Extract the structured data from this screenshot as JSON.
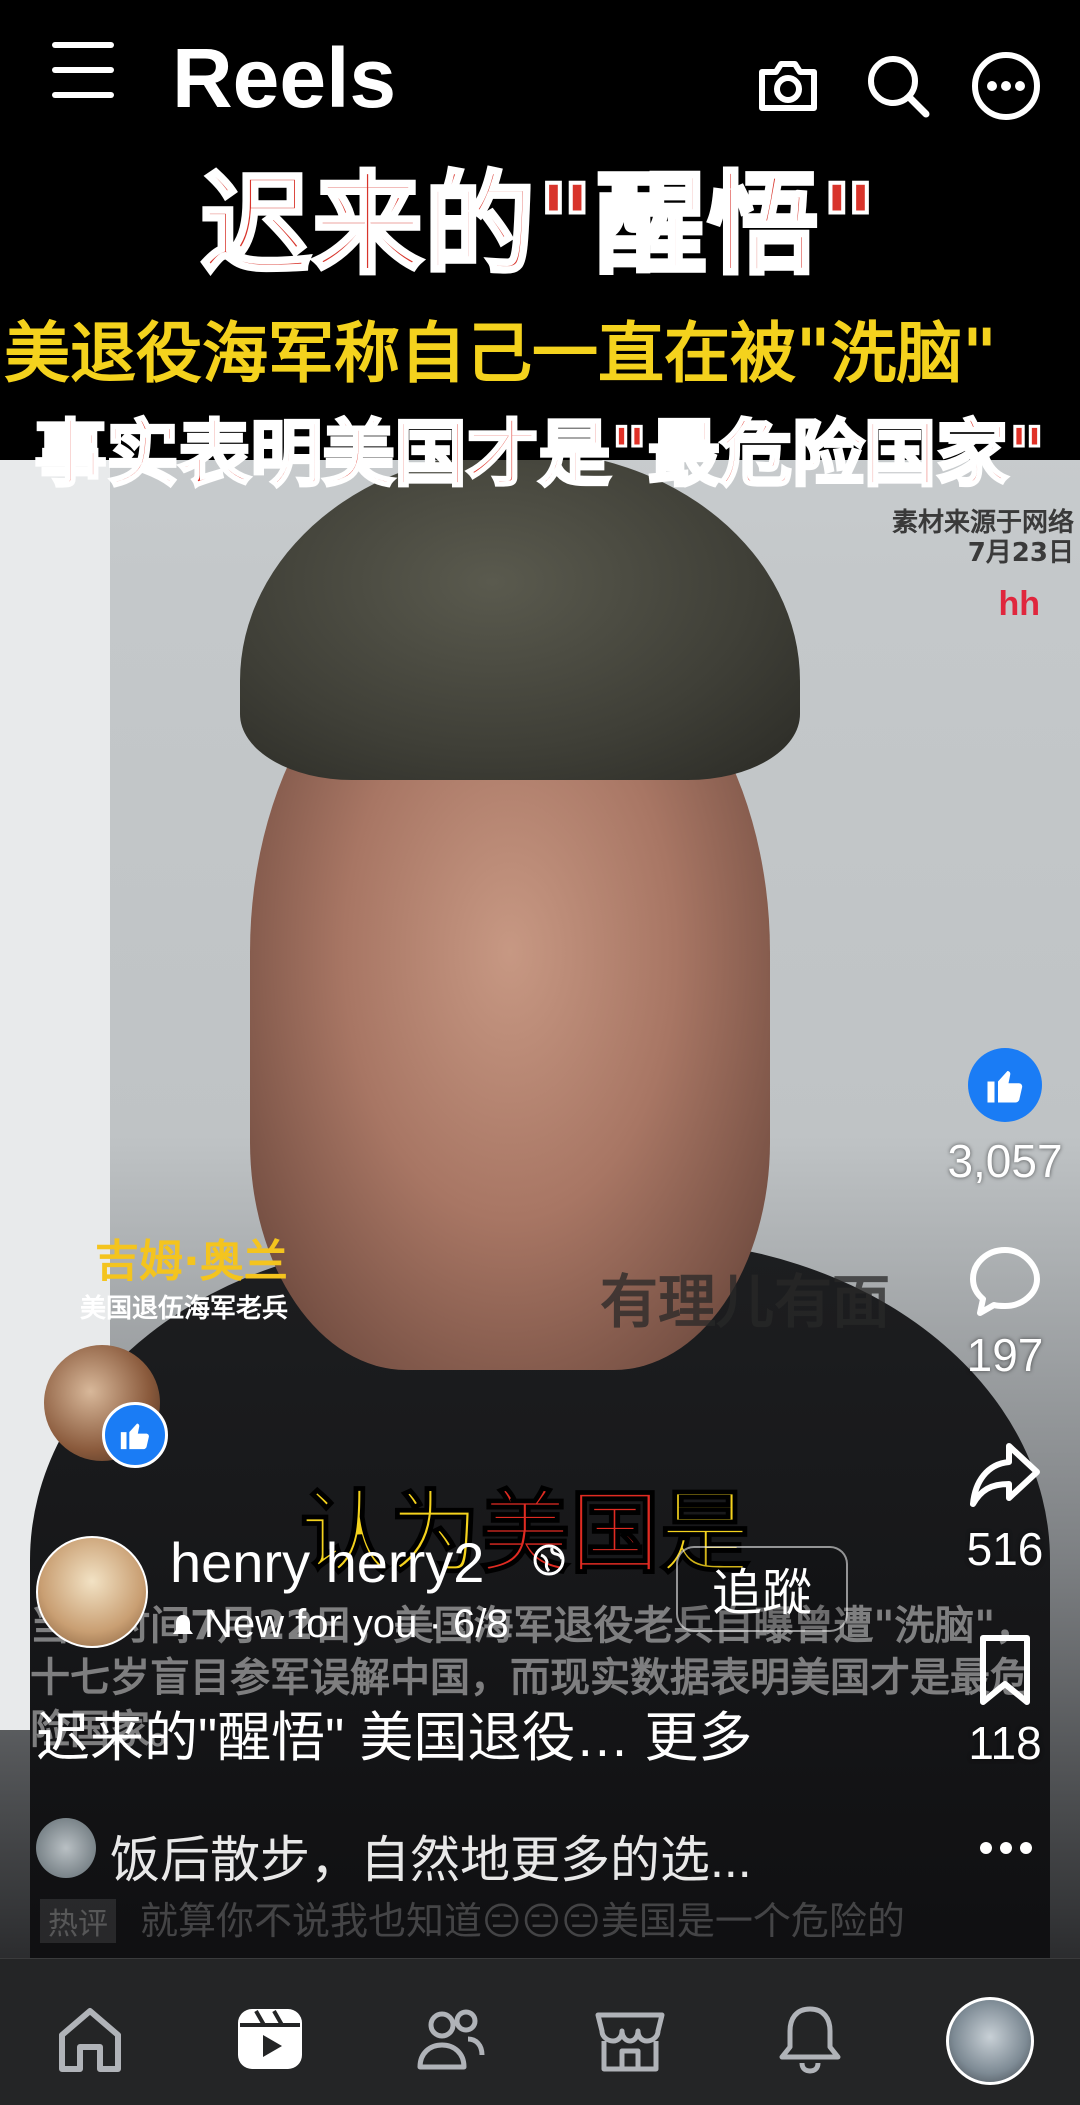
{
  "header": {
    "title": "Reels",
    "icons": [
      "menu-icon",
      "camera-icon",
      "search-icon",
      "more-icon"
    ]
  },
  "video": {
    "headline_main": "迟来的\"醒悟\"",
    "headline_yellow": "美退役海军称自己一直在被\"洗脑\"",
    "headline_red": "事实表明美国才是\"最危险国家\"",
    "source_note_line1": "素材来源于网络",
    "source_note_line2": "7月23日",
    "channel_mark": "hh",
    "name_tag": "吉姆·奥兰",
    "name_sub": "美国退伍海军老兵",
    "watermark": "有理儿有面",
    "caption_part1": "认为",
    "caption_part2": "美国",
    "caption_part3": "是",
    "subtitle": "当地时间7月22日，美国海军退役老兵自曝曾遭\"洗脑\"，十七岁盲目参军误解中国，而现实数据表明美国才是最危险国家。"
  },
  "actions": {
    "likes": "3,057",
    "comments": "197",
    "shares": "516",
    "saves": "118"
  },
  "author": {
    "name": "henry herry2",
    "follow_label": "追蹤",
    "meta": "New for you · 6/8",
    "description": "迟来的\"醒悟\" 美国退役… 更多"
  },
  "comment": {
    "preview": "饭后散步，自然地更多的选...",
    "hot_tag": "热评",
    "hot_text": "就算你不说我也知道😑😑😑美国是一个危险的"
  },
  "bottom_nav": {
    "items": [
      "home-icon",
      "reels-icon",
      "friends-icon",
      "marketplace-icon",
      "notifications-icon",
      "profile-avatar"
    ]
  },
  "colors": {
    "accent_blue": "#1a7cf5",
    "nav_bg": "#242526",
    "headline_red": "#d8342b",
    "headline_yellow": "#f4d21d"
  }
}
